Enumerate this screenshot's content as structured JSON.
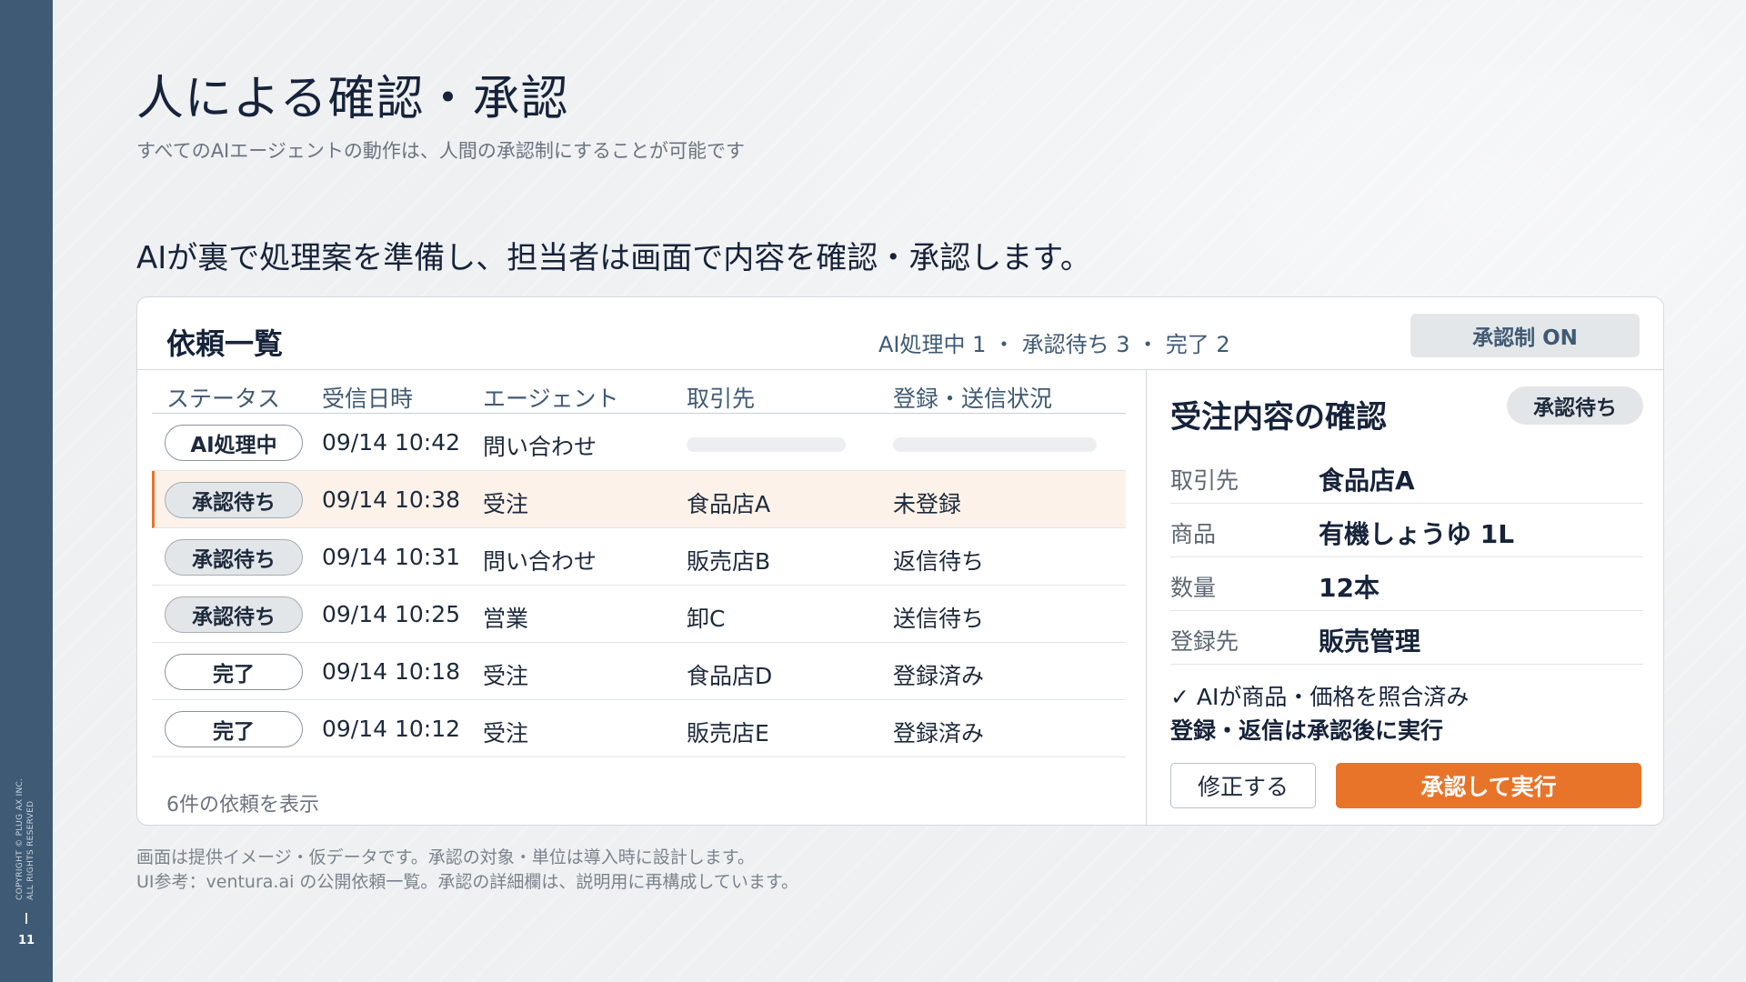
{
  "sidebar": {
    "copyright_line1": "COPYRIGHT © PLUG AX INC.",
    "copyright_line2": "ALL RIGHTS RESERVED",
    "page_number": "11"
  },
  "header": {
    "title": "人による確認・承認",
    "subtitle": "すべてのAIエージェントの動作は、人間の承認制にすることが可能です"
  },
  "lead": "AIが裏で処理案を準備し、担当者は画面で内容を確認・承認します。",
  "panel": {
    "title": "依頼一覧",
    "summary": "AI処理中 1 ・ 承認待ち 3 ・ 完了 2",
    "approval_toggle": "承認制 ON",
    "columns": [
      "ステータス",
      "受信日時",
      "エージェント",
      "取引先",
      "登録・送信状況"
    ],
    "rows": [
      {
        "status": "AI処理中",
        "datetime": "09/14 10:42",
        "agent": "問い合わせ",
        "client": "",
        "state": ""
      },
      {
        "status": "承認待ち",
        "datetime": "09/14 10:38",
        "agent": "受注",
        "client": "食品店A",
        "state": "未登録"
      },
      {
        "status": "承認待ち",
        "datetime": "09/14 10:31",
        "agent": "問い合わせ",
        "client": "販売店B",
        "state": "返信待ち"
      },
      {
        "status": "承認待ち",
        "datetime": "09/14 10:25",
        "agent": "営業",
        "client": "卸C",
        "state": "送信待ち"
      },
      {
        "status": "完了",
        "datetime": "09/14 10:18",
        "agent": "受注",
        "client": "食品店D",
        "state": "登録済み"
      },
      {
        "status": "完了",
        "datetime": "09/14 10:12",
        "agent": "受注",
        "client": "販売店E",
        "state": "登録済み"
      }
    ],
    "footer": "6件の依頼を表示"
  },
  "detail": {
    "title": "受注内容の確認",
    "badge": "承認待ち",
    "fields": [
      {
        "label": "取引先",
        "value": "食品店A"
      },
      {
        "label": "商品",
        "value": "有機しょうゆ 1L"
      },
      {
        "label": "数量",
        "value": "12本"
      },
      {
        "label": "登録先",
        "value": "販売管理"
      }
    ],
    "check_line": "✓ AIが商品・価格を照合済み",
    "note_line": "登録・返信は承認後に実行",
    "edit_button": "修正する",
    "approve_button": "承認して実行"
  },
  "footnotes": [
    "画面は提供イメージ・仮データです。承認の対象・単位は導入時に設計します。",
    "UI参考：ventura.ai の公開依頼一覧。承認の詳細欄は、説明用に再構成しています。"
  ],
  "colors": {
    "sidebar": "#3f5a74",
    "accent_orange": "#e8742a",
    "selected_row": "#fdf2e9",
    "title_navy": "#16233a"
  }
}
